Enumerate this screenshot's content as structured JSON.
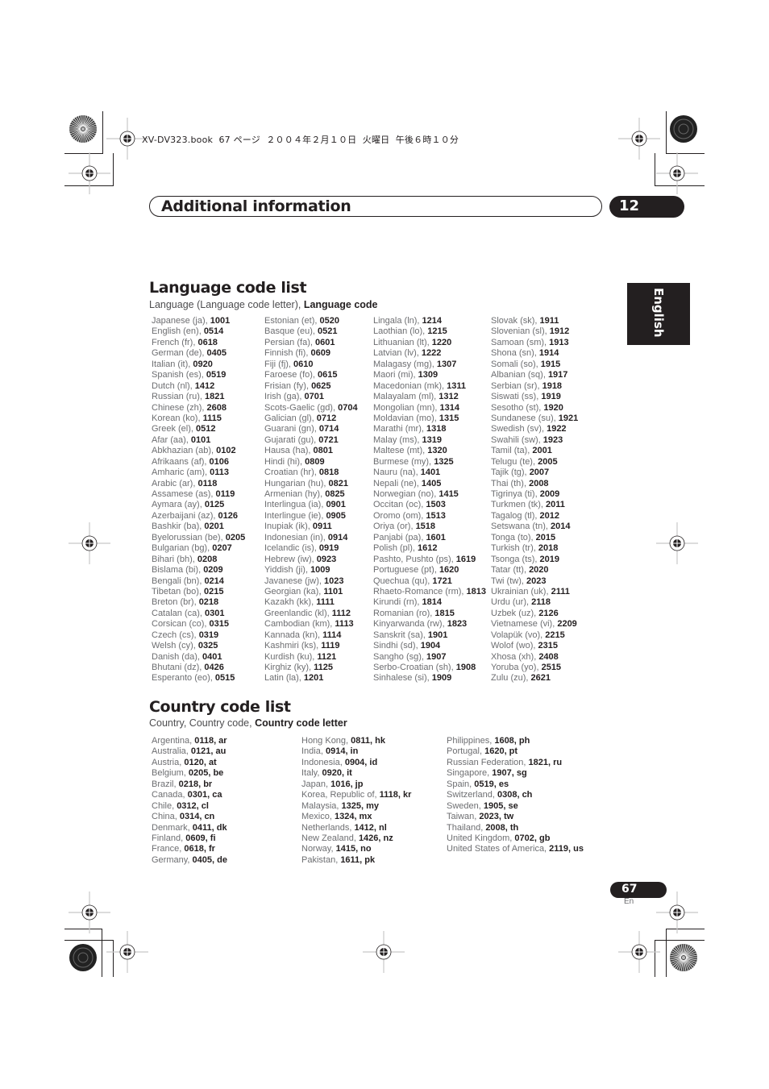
{
  "print_header": "XV-DV323.book  67 ページ  ２００４年２月１０日  火曜日  午後６時１０分",
  "chapter": {
    "title": "Additional information",
    "number": "12"
  },
  "side_tab": "English",
  "language_section": {
    "title": "Language code list",
    "subtitle_plain": "Language (Language code letter), ",
    "subtitle_bold": "Language code",
    "columns": [
      [
        [
          "Japanese (ja), ",
          "1001"
        ],
        [
          "English (en), ",
          "0514"
        ],
        [
          "French (fr), ",
          "0618"
        ],
        [
          "German (de), ",
          "0405"
        ],
        [
          "Italian (it), ",
          "0920"
        ],
        [
          "Spanish (es), ",
          "0519"
        ],
        [
          "Dutch (nl), ",
          "1412"
        ],
        [
          "Russian (ru), ",
          "1821"
        ],
        [
          "Chinese (zh), ",
          "2608"
        ],
        [
          "Korean (ko), ",
          "1115"
        ],
        [
          "Greek (el), ",
          "0512"
        ],
        [
          "Afar (aa), ",
          "0101"
        ],
        [
          "Abkhazian (ab), ",
          "0102"
        ],
        [
          "Afrikaans (af), ",
          "0106"
        ],
        [
          "Amharic (am), ",
          "0113"
        ],
        [
          "Arabic (ar), ",
          "0118"
        ],
        [
          "Assamese (as), ",
          "0119"
        ],
        [
          "Aymara (ay), ",
          "0125"
        ],
        [
          "Azerbaijani (az), ",
          "0126"
        ],
        [
          "Bashkir (ba), ",
          "0201"
        ],
        [
          "Byelorussian (be), ",
          "0205"
        ],
        [
          "Bulgarian (bg), ",
          "0207"
        ],
        [
          "Bihari (bh), ",
          "0208"
        ],
        [
          "Bislama (bi), ",
          "0209"
        ],
        [
          "Bengali (bn), ",
          "0214"
        ],
        [
          "Tibetan (bo), ",
          "0215"
        ],
        [
          "Breton (br), ",
          "0218"
        ],
        [
          "Catalan (ca), ",
          "0301"
        ],
        [
          "Corsican (co), ",
          "0315"
        ],
        [
          "Czech (cs), ",
          "0319"
        ],
        [
          "Welsh (cy), ",
          "0325"
        ],
        [
          "Danish (da), ",
          "0401"
        ],
        [
          "Bhutani (dz), ",
          "0426"
        ],
        [
          "Esperanto (eo), ",
          "0515"
        ]
      ],
      [
        [
          "Estonian (et), ",
          "0520"
        ],
        [
          "Basque (eu), ",
          "0521"
        ],
        [
          "Persian (fa), ",
          "0601"
        ],
        [
          "Finnish (fi), ",
          "0609"
        ],
        [
          "Fiji (fj), ",
          "0610"
        ],
        [
          "Faroese (fo), ",
          "0615"
        ],
        [
          "Frisian (fy), ",
          "0625"
        ],
        [
          "Irish (ga), ",
          "0701"
        ],
        [
          "Scots-Gaelic (gd), ",
          "0704"
        ],
        [
          "Galician (gl), ",
          "0712"
        ],
        [
          "Guarani (gn), ",
          "0714"
        ],
        [
          "Gujarati (gu), ",
          "0721"
        ],
        [
          "Hausa (ha), ",
          "0801"
        ],
        [
          "Hindi (hi), ",
          "0809"
        ],
        [
          "Croatian (hr), ",
          "0818"
        ],
        [
          "Hungarian (hu), ",
          "0821"
        ],
        [
          "Armenian (hy), ",
          "0825"
        ],
        [
          "Interlingua (ia), ",
          "0901"
        ],
        [
          "Interlingue (ie), ",
          "0905"
        ],
        [
          "Inupiak (ik), ",
          "0911"
        ],
        [
          "Indonesian (in), ",
          "0914"
        ],
        [
          "Icelandic (is), ",
          "0919"
        ],
        [
          "Hebrew (iw), ",
          "0923"
        ],
        [
          "Yiddish (ji), ",
          "1009"
        ],
        [
          "Javanese (jw), ",
          "1023"
        ],
        [
          "Georgian (ka), ",
          "1101"
        ],
        [
          "Kazakh (kk), ",
          "1111"
        ],
        [
          "Greenlandic  (kl), ",
          "1112"
        ],
        [
          "Cambodian (km), ",
          "1113"
        ],
        [
          "Kannada (kn), ",
          "1114"
        ],
        [
          "Kashmiri (ks), ",
          "1119"
        ],
        [
          "Kurdish (ku), ",
          "1121"
        ],
        [
          "Kirghiz (ky), ",
          "1125"
        ],
        [
          "Latin (la), ",
          "1201"
        ]
      ],
      [
        [
          "Lingala (ln), ",
          "1214"
        ],
        [
          "Laothian (lo), ",
          "1215"
        ],
        [
          "Lithuanian (lt), ",
          "1220"
        ],
        [
          "Latvian (lv), ",
          "1222"
        ],
        [
          "Malagasy (mg), ",
          "1307"
        ],
        [
          "Maori (mi), ",
          "1309"
        ],
        [
          "Macedonian (mk), ",
          "1311"
        ],
        [
          "Malayalam  (ml), ",
          "1312"
        ],
        [
          "Mongolian (mn), ",
          "1314"
        ],
        [
          "Moldavian (mo), ",
          "1315"
        ],
        [
          "Marathi (mr), ",
          "1318"
        ],
        [
          "Malay  (ms), ",
          "1319"
        ],
        [
          "Maltese (mt), ",
          "1320"
        ],
        [
          "Burmese (my), ",
          "1325"
        ],
        [
          "Nauru (na), ",
          "1401"
        ],
        [
          "Nepali (ne), ",
          "1405"
        ],
        [
          "Norwegian (no), ",
          "1415"
        ],
        [
          "Occitan (oc), ",
          "1503"
        ],
        [
          "Oromo (om), ",
          "1513"
        ],
        [
          "Oriya (or), ",
          "1518"
        ],
        [
          "Panjabi (pa), ",
          "1601"
        ],
        [
          "Polish (pl), ",
          "1612"
        ],
        [
          "Pashto, Pushto (ps), ",
          "1619"
        ],
        [
          "Portuguese (pt), ",
          "1620"
        ],
        [
          "Quechua (qu), ",
          "1721"
        ],
        [
          "Rhaeto-Romance (rm), ",
          "1813"
        ],
        [
          "Kirundi (rn), ",
          "1814"
        ],
        [
          "Romanian (ro), ",
          "1815"
        ],
        [
          "Kinyarwanda (rw), ",
          "1823"
        ],
        [
          "Sanskrit (sa), ",
          "1901"
        ],
        [
          "Sindhi (sd), ",
          "1904"
        ],
        [
          "Sangho (sg), ",
          "1907"
        ],
        [
          "Serbo-Croatian (sh), ",
          "1908"
        ],
        [
          "Sinhalese (si), ",
          "1909"
        ]
      ],
      [
        [
          "Slovak (sk), ",
          "1911"
        ],
        [
          "Slovenian (sl), ",
          "1912"
        ],
        [
          "Samoan (sm), ",
          "1913"
        ],
        [
          "Shona (sn), ",
          "1914"
        ],
        [
          "Somali (so), ",
          "1915"
        ],
        [
          "Albanian (sq), ",
          "1917"
        ],
        [
          "Serbian (sr), ",
          "1918"
        ],
        [
          "Siswati (ss), ",
          "1919"
        ],
        [
          "Sesotho (st), ",
          "1920"
        ],
        [
          "Sundanese (su), ",
          "1921"
        ],
        [
          "Swedish (sv), ",
          "1922"
        ],
        [
          "Swahili (sw), ",
          "1923"
        ],
        [
          "Tamil (ta), ",
          "2001"
        ],
        [
          "Telugu (te), ",
          "2005"
        ],
        [
          "Tajik (tg), ",
          "2007"
        ],
        [
          "Thai (th), ",
          "2008"
        ],
        [
          "Tigrinya (ti), ",
          "2009"
        ],
        [
          "Turkmen (tk), ",
          "2011"
        ],
        [
          "Tagalog (tl), ",
          "2012"
        ],
        [
          "Setswana (tn), ",
          "2014"
        ],
        [
          "Tonga (to), ",
          "2015"
        ],
        [
          "Turkish (tr), ",
          "2018"
        ],
        [
          "Tsonga (ts), ",
          "2019"
        ],
        [
          "Tatar (tt), ",
          "2020"
        ],
        [
          "Twi (tw), ",
          "2023"
        ],
        [
          "Ukrainian (uk), ",
          "2111"
        ],
        [
          "Urdu (ur), ",
          "2118"
        ],
        [
          "Uzbek (uz), ",
          "2126"
        ],
        [
          "Vietnamese (vi), ",
          "2209"
        ],
        [
          "Volapük (vo), ",
          "2215"
        ],
        [
          "Wolof (wo), ",
          "2315"
        ],
        [
          "Xhosa (xh), ",
          "2408"
        ],
        [
          "Yoruba (yo), ",
          "2515"
        ],
        [
          "Zulu (zu), ",
          "2621"
        ]
      ]
    ]
  },
  "country_section": {
    "title": "Country code list",
    "subtitle_plain": "Country, Country code, ",
    "subtitle_bold": "Country code letter",
    "columns": [
      [
        [
          "Argentina, ",
          "0118, ar"
        ],
        [
          "Australia, ",
          "0121, au"
        ],
        [
          "Austria, ",
          "0120, at"
        ],
        [
          "Belgium, ",
          "0205, be"
        ],
        [
          "Brazil, ",
          "0218, br"
        ],
        [
          "Canada, ",
          "0301, ca"
        ],
        [
          "Chile, ",
          "0312, cl"
        ],
        [
          "China, ",
          "0314, cn"
        ],
        [
          "Denmark, ",
          "0411, dk"
        ],
        [
          "Finland, ",
          "0609, fi"
        ],
        [
          "France, ",
          "0618, fr"
        ],
        [
          "Germany, ",
          "0405, de"
        ]
      ],
      [
        [
          "Hong Kong, ",
          "0811, hk"
        ],
        [
          "India, ",
          "0914, in"
        ],
        [
          "Indonesia, ",
          "0904, id"
        ],
        [
          "Italy, ",
          "0920, it"
        ],
        [
          "Japan, ",
          "1016, jp"
        ],
        [
          "Korea, Republic of, ",
          "1118, kr"
        ],
        [
          "Malaysia, ",
          "1325, my"
        ],
        [
          "Mexico, ",
          "1324, mx"
        ],
        [
          "Netherlands, ",
          "1412, nl"
        ],
        [
          "New Zealand, ",
          "1426, nz"
        ],
        [
          "Norway, ",
          "1415, no"
        ],
        [
          "Pakistan, ",
          "1611, pk"
        ]
      ],
      [
        [
          "Philippines, ",
          "1608, ph"
        ],
        [
          "Portugal, ",
          "1620, pt"
        ],
        [
          "Russian Federation, ",
          "1821, ru"
        ],
        [
          "Singapore, ",
          "1907, sg"
        ],
        [
          "Spain, ",
          "0519, es"
        ],
        [
          "Switzerland, ",
          "0308, ch"
        ],
        [
          "Sweden, ",
          "1905, se"
        ],
        [
          "Taiwan, ",
          "2023, tw"
        ],
        [
          "Thailand, ",
          "2008, th"
        ],
        [
          "United Kingdom, ",
          "0702, gb"
        ],
        [
          "United States of America, ",
          "2119, us"
        ]
      ]
    ]
  },
  "footer": {
    "page_number": "67",
    "language": "En"
  },
  "icons": {
    "registration_mark": "crosshair-circle-icon",
    "color_target": "starburst-target-icon"
  }
}
